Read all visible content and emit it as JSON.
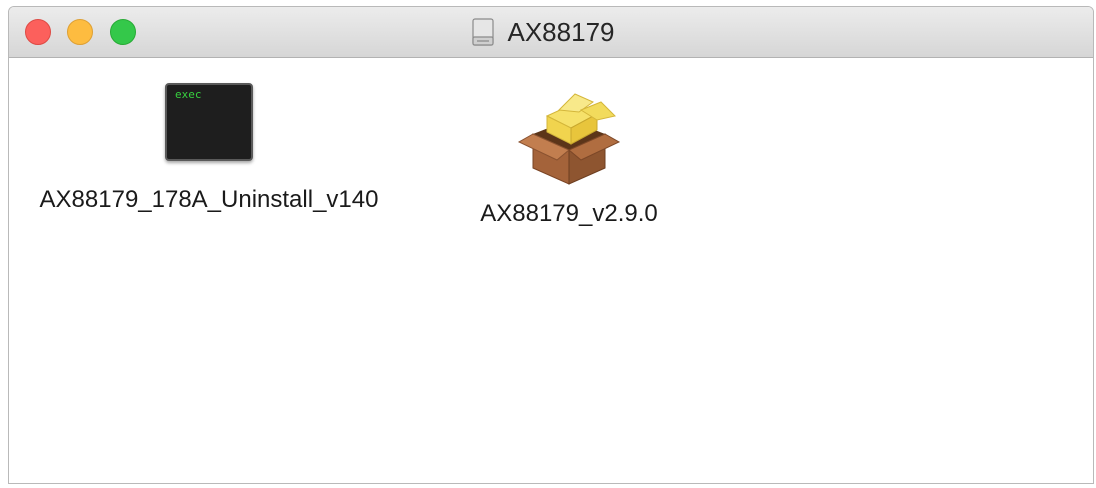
{
  "window": {
    "title": "AX88179",
    "title_icon": "drive-icon"
  },
  "traffic_lights": {
    "close_color": "#fc605c",
    "minimize_color": "#fdbc40",
    "zoom_color": "#34c84a"
  },
  "files": [
    {
      "name": "AX88179_178A_Uninstall_v140",
      "icon": "exec-icon",
      "icon_text": "exec"
    },
    {
      "name": "AX88179_v2.9.0",
      "icon": "package-icon"
    }
  ]
}
